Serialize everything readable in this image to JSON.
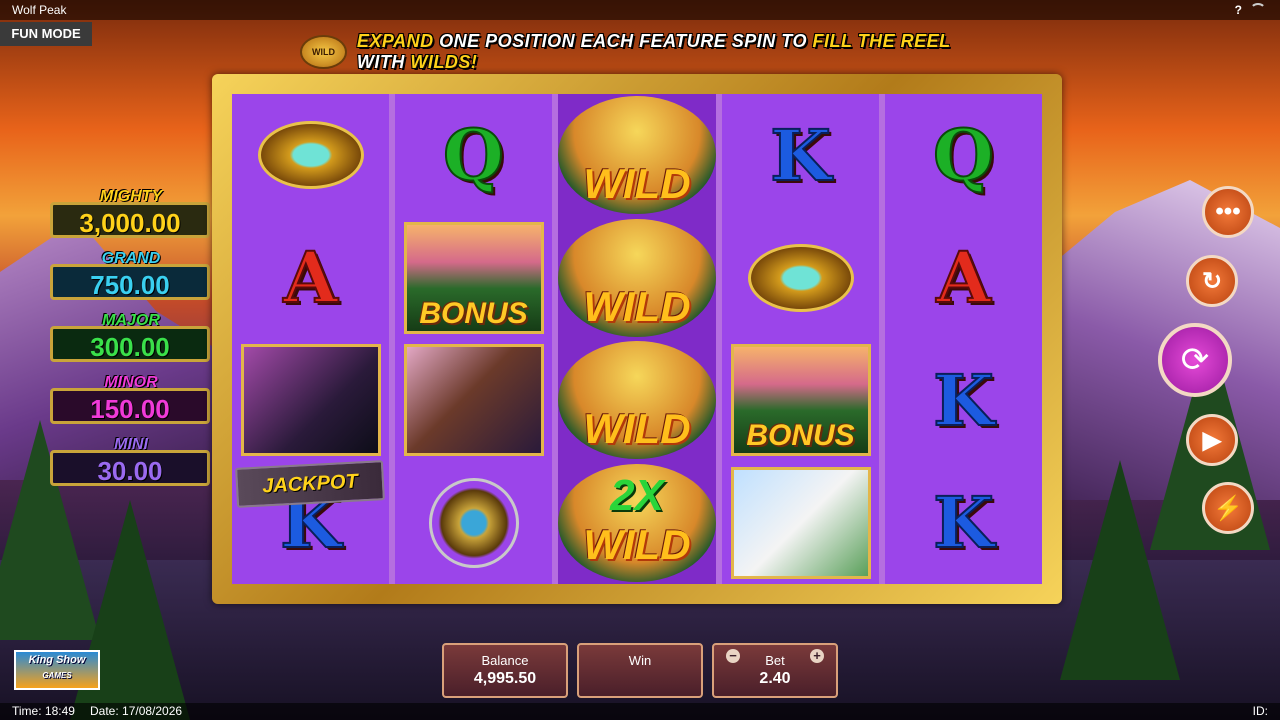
{
  "app": {
    "title": "Wolf Peak",
    "mode": "FUN MODE",
    "help": "?"
  },
  "banner": {
    "icon_label": "WILD",
    "parts": [
      {
        "text": "EXPAND",
        "highlight": true
      },
      {
        "text": " ONE POSITION EACH FEATURE SPIN TO ",
        "highlight": false
      },
      {
        "text": "FILL THE REEL",
        "highlight": true
      },
      {
        "text": " WITH ",
        "highlight": false
      },
      {
        "text": "WILDS!",
        "highlight": true
      }
    ]
  },
  "jackpots": [
    {
      "name": "MIGHTY",
      "value": "3,000.00",
      "name_color": "#ffd21a",
      "box_bg": "#2a2a10",
      "value_color": "#ffd21a"
    },
    {
      "name": "GRAND",
      "value": "750.00",
      "name_color": "#3ad0f0",
      "box_bg": "#0a2a3a",
      "value_color": "#3ad0f0"
    },
    {
      "name": "MAJOR",
      "value": "300.00",
      "name_color": "#3ae04a",
      "box_bg": "#0a2a10",
      "value_color": "#3ae04a"
    },
    {
      "name": "MINOR",
      "value": "150.00",
      "name_color": "#f03ad8",
      "box_bg": "#2a0a2a",
      "value_color": "#f03ad8"
    },
    {
      "name": "MINI",
      "value": "30.00",
      "name_color": "#9a6af0",
      "box_bg": "#1a0f2a",
      "value_color": "#9a6af0"
    }
  ],
  "reels": [
    {
      "cells": [
        {
          "type": "amulet"
        },
        {
          "type": "letter",
          "value": "A"
        },
        {
          "type": "pic",
          "style": "wolf"
        },
        {
          "type": "letter",
          "value": "K",
          "tag": "JACKPOT"
        }
      ]
    },
    {
      "cells": [
        {
          "type": "letter",
          "value": "Q"
        },
        {
          "type": "pic",
          "style": "bonus",
          "label": "BONUS"
        },
        {
          "type": "pic",
          "style": "eagle"
        },
        {
          "type": "dream"
        }
      ]
    },
    {
      "highlight": true,
      "cells": [
        {
          "type": "wild",
          "label": "WILD"
        },
        {
          "type": "wild",
          "label": "WILD"
        },
        {
          "type": "wild",
          "label": "WILD"
        },
        {
          "type": "wild2x",
          "mult": "2X",
          "label": "WILD"
        }
      ]
    },
    {
      "cells": [
        {
          "type": "letter",
          "value": "K"
        },
        {
          "type": "amulet"
        },
        {
          "type": "pic",
          "style": "bonus",
          "label": "BONUS"
        },
        {
          "type": "pic",
          "style": "whitewolf"
        }
      ]
    },
    {
      "cells": [
        {
          "type": "letter",
          "value": "Q"
        },
        {
          "type": "letter",
          "value": "A"
        },
        {
          "type": "letter",
          "value": "K"
        },
        {
          "type": "letter",
          "value": "K"
        }
      ]
    }
  ],
  "controls": {
    "menu_icon": "more-icon",
    "autoplay_icon": "autoplay-icon",
    "spin_icon": "spin-icon",
    "replay_icon": "replay-icon",
    "turbo_icon": "turbo-icon"
  },
  "footer": {
    "balance_label": "Balance",
    "balance_value": "4,995.50",
    "win_label": "Win",
    "win_value": "",
    "bet_label": "Bet",
    "bet_value": "2.40",
    "bet_minus": "−",
    "bet_plus": "+"
  },
  "logo": {
    "line1": "King Show",
    "line2": "GAMES"
  },
  "status": {
    "time": "Time: 18:49",
    "date": "Date: 17/08/2026",
    "id": "ID:"
  },
  "colors": {
    "accent": "#ffd21a",
    "reel_bg": "#9b45ea"
  }
}
